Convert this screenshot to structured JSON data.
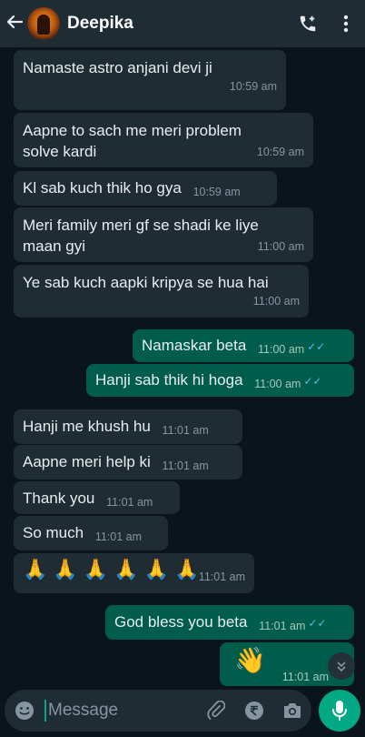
{
  "header": {
    "contact_name": "Deepika",
    "back_icon": "arrow-left-icon",
    "call_icon": "add-call-icon",
    "menu_icon": "more-vert-icon"
  },
  "messages": [
    {
      "dir": "in",
      "text": "Namaste astro anjani devi ji",
      "time": "10:59 am"
    },
    {
      "dir": "in",
      "text": "Aapne to sach me meri problem solve kardi",
      "time": "10:59 am"
    },
    {
      "dir": "in",
      "text": "Kl sab kuch thik ho gya",
      "time": "10:59 am"
    },
    {
      "dir": "in",
      "text": "Meri family meri gf se shadi ke liye maan gyi",
      "time": "11:00 am"
    },
    {
      "dir": "in",
      "text": "Ye sab kuch aapki kripya se hua hai",
      "time": "11:00 am"
    },
    {
      "dir": "out",
      "text": "Namaskar beta",
      "time": "11:00 am"
    },
    {
      "dir": "out",
      "text": "Hanji sab thik hi hoga",
      "time": "11:00 am"
    },
    {
      "dir": "in",
      "text": "Hanji me khush hu",
      "time": "11:01 am"
    },
    {
      "dir": "in",
      "text": "Aapne meri help ki",
      "time": "11:01 am"
    },
    {
      "dir": "in",
      "text": "Thank you",
      "time": "11:01 am"
    },
    {
      "dir": "in",
      "text": "So much",
      "time": "11:01 am"
    },
    {
      "dir": "in",
      "text": "🙏🙏🙏🙏🙏🙏",
      "time": "11:01 am"
    },
    {
      "dir": "out",
      "text": "God bless you beta",
      "time": "11:01 am"
    },
    {
      "dir": "out",
      "text": "👋",
      "time": "11:01 am"
    }
  ],
  "read_ticks": "✓✓",
  "composer": {
    "placeholder": "Message",
    "emoji_icon": "emoji-icon",
    "attach_icon": "attach-icon",
    "payment_icon": "rupee-icon",
    "camera_icon": "camera-icon",
    "mic_icon": "mic-icon"
  },
  "colors": {
    "background": "#0b141a",
    "header": "#1f2c34",
    "incoming_bubble": "#1f2c34",
    "outgoing_bubble": "#005c4b",
    "accent": "#00a884",
    "read_tick": "#53bdeb"
  }
}
